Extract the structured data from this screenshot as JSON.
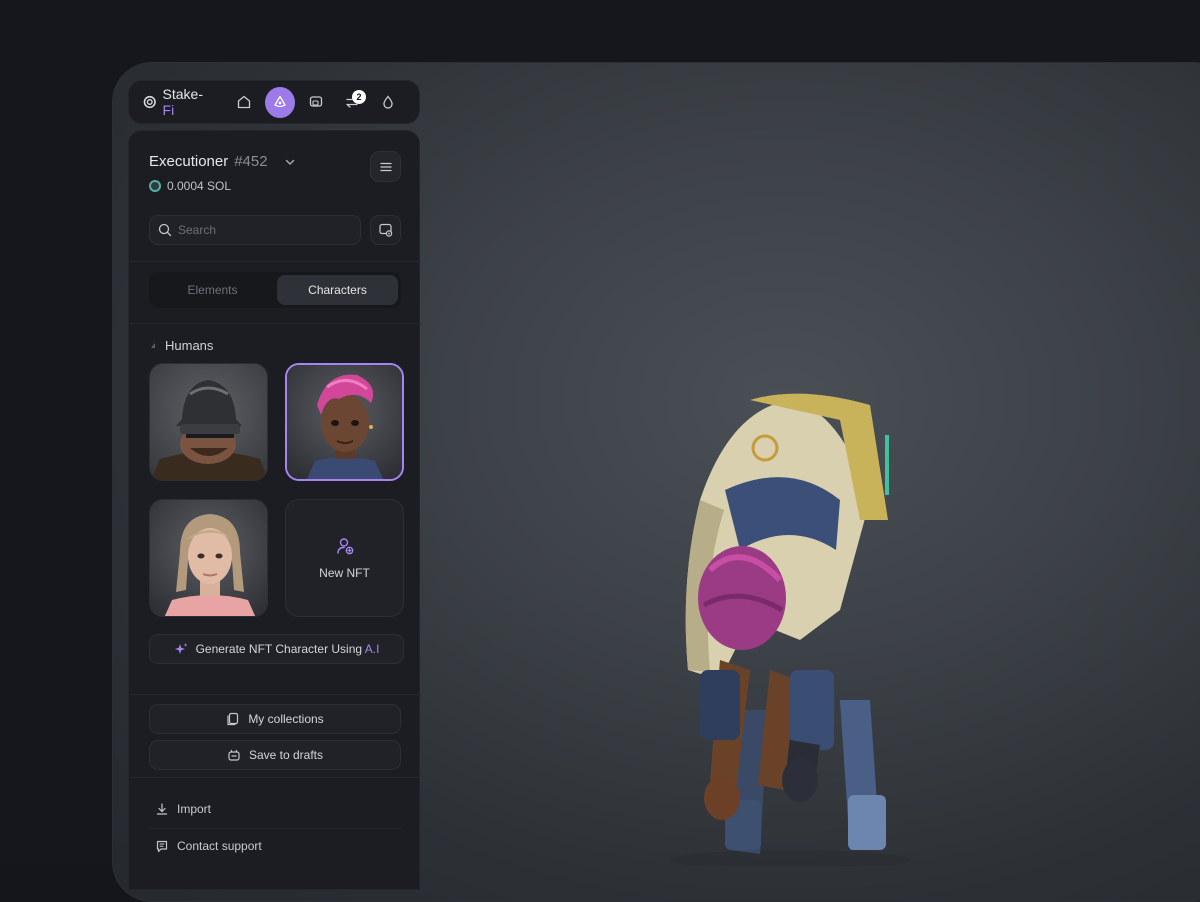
{
  "brand": {
    "name": "Stake-",
    "accent": "Fi"
  },
  "topnav": {
    "items": [
      {
        "icon": "home-icon"
      },
      {
        "icon": "character-icon",
        "active": true
      },
      {
        "icon": "gallery-icon"
      },
      {
        "icon": "transfer-icon",
        "badge": "2"
      },
      {
        "icon": "drop-icon"
      }
    ]
  },
  "header": {
    "title": "Executioner",
    "number": "#452",
    "balance": "0.0004 SOL"
  },
  "search": {
    "placeholder": "Search",
    "value": ""
  },
  "tabs": [
    {
      "label": "Elements",
      "active": false
    },
    {
      "label": "Characters",
      "active": true
    }
  ],
  "section": {
    "label": "Humans"
  },
  "characters": [
    {
      "name": "knight"
    },
    {
      "name": "pink-hair-girl",
      "selected": true
    },
    {
      "name": "blonde-woman"
    }
  ],
  "new_nft": {
    "label": "New NFT"
  },
  "generate": {
    "label": "Generate NFT Character Using ",
    "accent": "A.I"
  },
  "actions": {
    "collections": "My collections",
    "drafts": "Save to drafts",
    "import": "Import",
    "support": "Contact support"
  },
  "colors": {
    "accent": "#a884f3",
    "panel": "#1b1d22",
    "active_nav": "#9c7ae8"
  }
}
